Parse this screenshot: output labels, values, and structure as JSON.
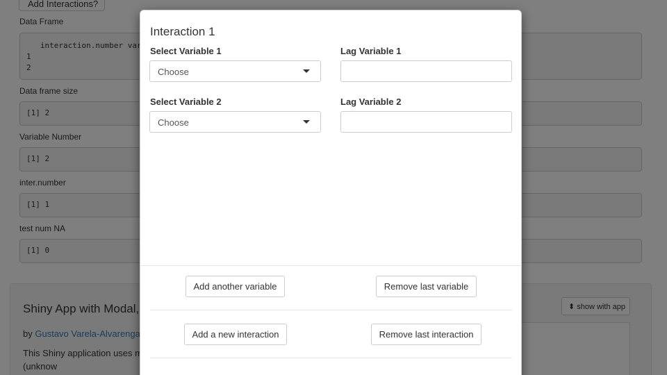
{
  "background": {
    "top_button_label": "Add Interactions?",
    "sections": [
      {
        "label": "Data Frame",
        "output_lines": [
          "   interaction.number variab",
          "1",
          "2"
        ]
      },
      {
        "label": "Data frame size",
        "output_lines": [
          "[1] 2"
        ]
      },
      {
        "label": "Variable Number",
        "output_lines": [
          "[1] 2"
        ]
      },
      {
        "label": "inter.number",
        "output_lines": [
          "[1] 1"
        ]
      },
      {
        "label": "test num NA",
        "output_lines": [
          "[1] 0"
        ]
      }
    ],
    "info": {
      "title": "Shiny App with Modal, some jQuery.",
      "by_prefix": "by",
      "author": "Gustavo Varela-Alvarenga",
      "description": "This Shiny application uses m remove an indefinite (unknow",
      "show_with_app_label": "show with app",
      "show_with_app_icon": "up-arrow-icon"
    }
  },
  "modal": {
    "title": "Interaction 1",
    "rows": [
      {
        "select_label": "Select Variable 1",
        "select_value": "Choose",
        "lag_label": "Lag Variable 1",
        "lag_value": ""
      },
      {
        "select_label": "Select Variable 2",
        "select_value": "Choose",
        "lag_label": "Lag Variable 2",
        "lag_value": ""
      }
    ],
    "buttons": {
      "add_variable": "Add another variable",
      "remove_variable": "Remove last variable",
      "add_interaction": "Add a new interaction",
      "remove_interaction": "Remove last interaction"
    }
  }
}
